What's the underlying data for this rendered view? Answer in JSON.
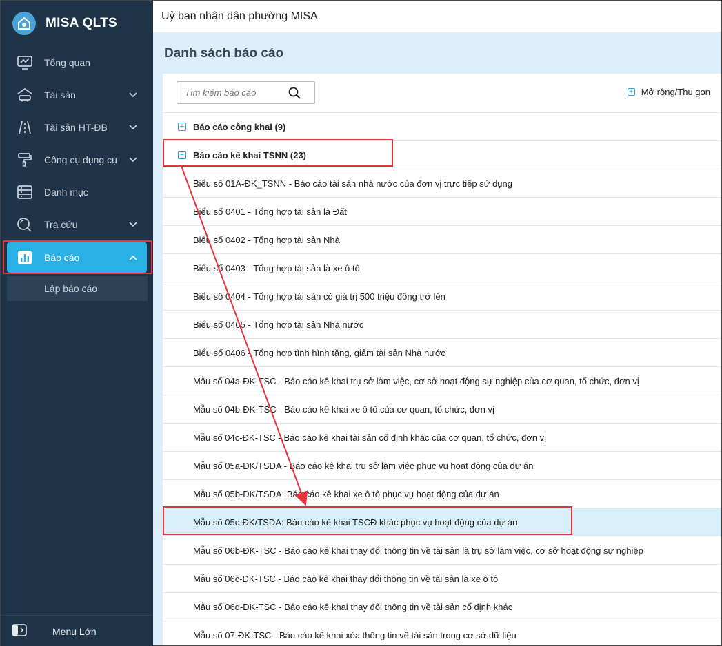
{
  "app": {
    "name": "MISA QLTS"
  },
  "sidebar": {
    "items": [
      {
        "label": "Tổng quan"
      },
      {
        "label": "Tài sản"
      },
      {
        "label": "Tài sản HT-ĐB"
      },
      {
        "label": "Công cụ dụng cụ"
      },
      {
        "label": "Danh mục"
      },
      {
        "label": "Tra cứu"
      },
      {
        "label": "Báo cáo"
      }
    ],
    "subitem": "Lập báo cáo",
    "footer": "Menu Lớn"
  },
  "header": {
    "title": "Uỷ ban nhân dân phường MISA"
  },
  "main": {
    "title": "Danh sách báo cáo",
    "search_placeholder": "Tìm kiếm báo cáo",
    "expand_label": "Mở rộng/Thu gọn",
    "groups": [
      {
        "label": "Báo cáo công khai (9)"
      },
      {
        "label": "Báo cáo kê khai TSNN (23)"
      }
    ],
    "reports": [
      "Biểu số 01A-ĐK_TSNN - Báo cáo tài sản nhà nước của đơn vị trực tiếp sử dụng",
      "Biểu số 0401 - Tổng hợp tài sản là Đất",
      "Biểu số 0402 - Tổng hợp tài sản Nhà",
      "Biểu số 0403 - Tổng hợp tài sản là xe ô tô",
      "Biểu số 0404 - Tổng hợp tài sản có giá trị 500 triệu đồng trở lên",
      "Biểu số 0405 - Tổng hợp tài sản Nhà nước",
      "Biểu số 0406 - Tổng hợp tình hình tăng, giảm tài sản Nhà nước",
      "Mẫu số 04a-ĐK-TSC - Báo cáo kê khai trụ sở làm việc, cơ sở hoạt động sự nghiệp của cơ quan, tổ chức, đơn vị",
      "Mẫu số 04b-ĐK-TSC - Báo cáo kê khai xe ô tô của cơ quan, tổ chức, đơn vị",
      "Mẫu số 04c-ĐK-TSC - Báo cáo kê khai tài sản cố định khác của cơ quan, tổ chức, đơn vị",
      "Mẫu số 05a-ĐK/TSDA - Báo cáo kê khai trụ sở làm việc phục vụ hoạt động của dự án",
      "Mẫu số 05b-ĐK/TSDA: Báo cáo kê khai xe ô tô phục vụ hoạt động của dự án",
      "Mẫu số 05c-ĐK/TSDA: Báo cáo kê khai TSCĐ khác phục vụ hoạt động của dự án",
      "Mẫu số 06b-ĐK-TSC - Báo cáo kê khai thay đổi thông tin về tài sản là trụ sở làm việc, cơ sở hoạt động sự nghiệp",
      "Mẫu số 06c-ĐK-TSC - Báo cáo kê khai thay đổi thông tin về tài sản là xe ô tô",
      "Mẫu số 06d-ĐK-TSC - Báo cáo kê khai thay đổi thông tin về tài sản cố định khác",
      "Mẫu số 07-ĐK-TSC - Báo cáo kê khai xóa thông tin về tài sản trong cơ sở dữ liệu"
    ]
  },
  "colors": {
    "sidebar_bg": "#1f3448",
    "accent": "#2ab0e4",
    "highlight": "#e5343b",
    "content_bg": "#dbeefa"
  }
}
